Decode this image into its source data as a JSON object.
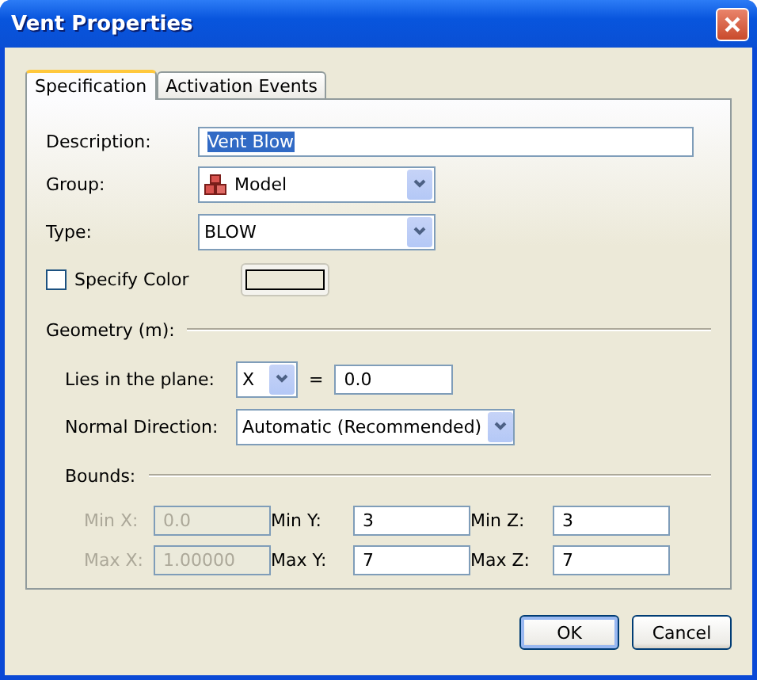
{
  "window": {
    "title": "Vent Properties"
  },
  "tabs": [
    {
      "label": "Specification",
      "selected": true
    },
    {
      "label": "Activation Events",
      "selected": false
    }
  ],
  "description": {
    "label": "Description:",
    "value": "Vent Blow",
    "highlighted": true
  },
  "group": {
    "label": "Group:",
    "value": "Model"
  },
  "type": {
    "label": "Type:",
    "value": "BLOW"
  },
  "specify_color": {
    "label": "Specify Color",
    "checked": false
  },
  "geometry": {
    "heading": "Geometry (m):",
    "plane": {
      "label": "Lies in the plane:",
      "axis": "X",
      "equals": "=",
      "value": "0.0"
    },
    "normal_direction": {
      "label": "Normal Direction:",
      "value": "Automatic (Recommended)"
    }
  },
  "bounds": {
    "heading": "Bounds:",
    "fields": [
      {
        "label": "Min X:",
        "value": "0.0",
        "disabled": true
      },
      {
        "label": "Min Y:",
        "value": "3",
        "disabled": false
      },
      {
        "label": "Min Z:",
        "value": "3",
        "disabled": false
      },
      {
        "label": "Max X:",
        "value": "1.00000",
        "disabled": true
      },
      {
        "label": "Max Y:",
        "value": "7",
        "disabled": false
      },
      {
        "label": "Max Z:",
        "value": "7",
        "disabled": false
      }
    ]
  },
  "buttons": [
    {
      "label": "OK",
      "default": true
    },
    {
      "label": "Cancel",
      "default": false
    }
  ]
}
